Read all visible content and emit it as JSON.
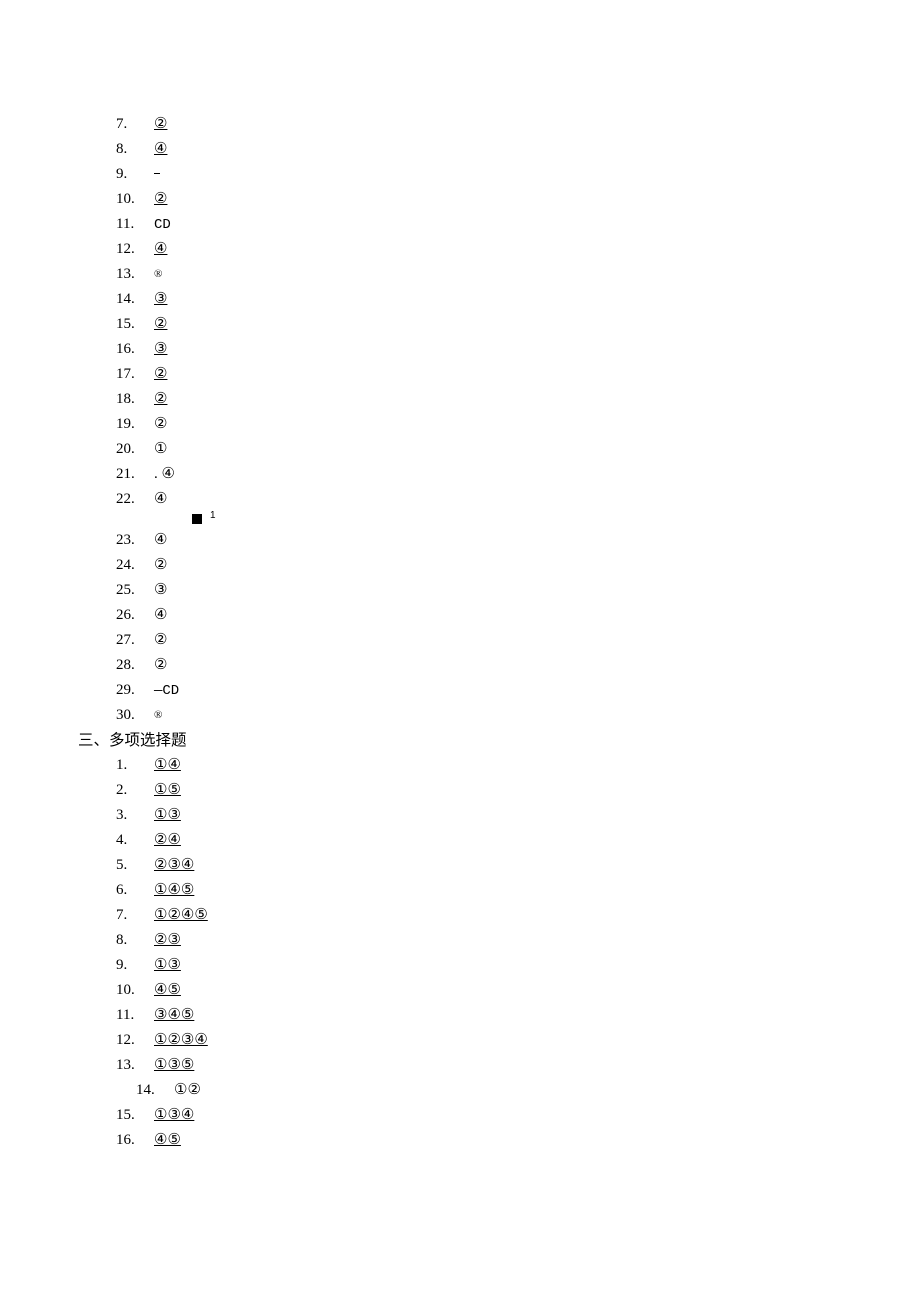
{
  "section2_items": [
    {
      "num": "7.",
      "ans": "②",
      "underline": true
    },
    {
      "num": "8.",
      "ans": "④",
      "underline": true
    },
    {
      "num": "9.",
      "ans": "_",
      "underline": false,
      "dash": true
    },
    {
      "num": "10.",
      "ans": "②",
      "underline": true
    },
    {
      "num": "11.",
      "ans": "CD",
      "underline": false,
      "mono": true
    },
    {
      "num": "12.",
      "ans": "④",
      "underline": true
    },
    {
      "num": "13.",
      "ans": "®",
      "underline": false,
      "small": true
    },
    {
      "num": "14.",
      "ans": "③",
      "underline": true
    },
    {
      "num": "15.",
      "ans": "②",
      "underline": true
    },
    {
      "num": "16.",
      "ans": "③",
      "underline": true
    },
    {
      "num": "17.",
      "ans": "②",
      "underline": true
    },
    {
      "num": "18.",
      "ans": "②",
      "underline": true
    },
    {
      "num": "19.",
      "ans": "②",
      "underline": false
    },
    {
      "num": "20.",
      "ans": "①",
      "underline": false
    },
    {
      "num": "21.",
      "ans": ". ④",
      "underline": false
    },
    {
      "num": "22.",
      "ans": "④",
      "underline": false
    }
  ],
  "marker": {
    "label": "1"
  },
  "section2_items_b": [
    {
      "num": "23.",
      "ans": "④",
      "underline": false
    },
    {
      "num": "24.",
      "ans": "②",
      "underline": false
    },
    {
      "num": "25.",
      "ans": "③",
      "underline": false
    },
    {
      "num": "26.",
      "ans": "④",
      "underline": false
    },
    {
      "num": "27.",
      "ans": "②",
      "underline": false
    },
    {
      "num": "28.",
      "ans": "②",
      "underline": false
    },
    {
      "num": "29.",
      "ans": "—CD",
      "underline": false,
      "mono": true
    },
    {
      "num": "30.",
      "ans": "®",
      "underline": false,
      "small": true
    }
  ],
  "section3_heading": "三、多项选择题",
  "section3_items": [
    {
      "num": "1.",
      "ans": "①④",
      "underline": true
    },
    {
      "num": "2.",
      "ans": "①⑤",
      "underline": true
    },
    {
      "num": "3.",
      "ans": "①③",
      "underline": true
    },
    {
      "num": "4.",
      "ans": "②④",
      "underline": true
    },
    {
      "num": "5.",
      "ans": "②③④",
      "underline": true
    },
    {
      "num": "6.",
      "ans": "①④⑤",
      "underline": true
    },
    {
      "num": "7.",
      "ans": "①②④⑤",
      "underline": true
    },
    {
      "num": "8.",
      "ans": "②③",
      "underline": true
    },
    {
      "num": "9.",
      "ans": "①③",
      "underline": true
    },
    {
      "num": "10.",
      "ans": "④⑤",
      "underline": true
    },
    {
      "num": "11.",
      "ans": "③④⑤",
      "underline": true
    },
    {
      "num": "12.",
      "ans": "①②③④",
      "underline": true
    },
    {
      "num": "13.",
      "ans": "①③⑤",
      "underline": true
    },
    {
      "num": "14.",
      "ans": "①②",
      "underline": false,
      "indent": true
    },
    {
      "num": "15.",
      "ans": "①③④",
      "underline": true
    },
    {
      "num": "16.",
      "ans": "④⑤",
      "underline": true
    }
  ]
}
